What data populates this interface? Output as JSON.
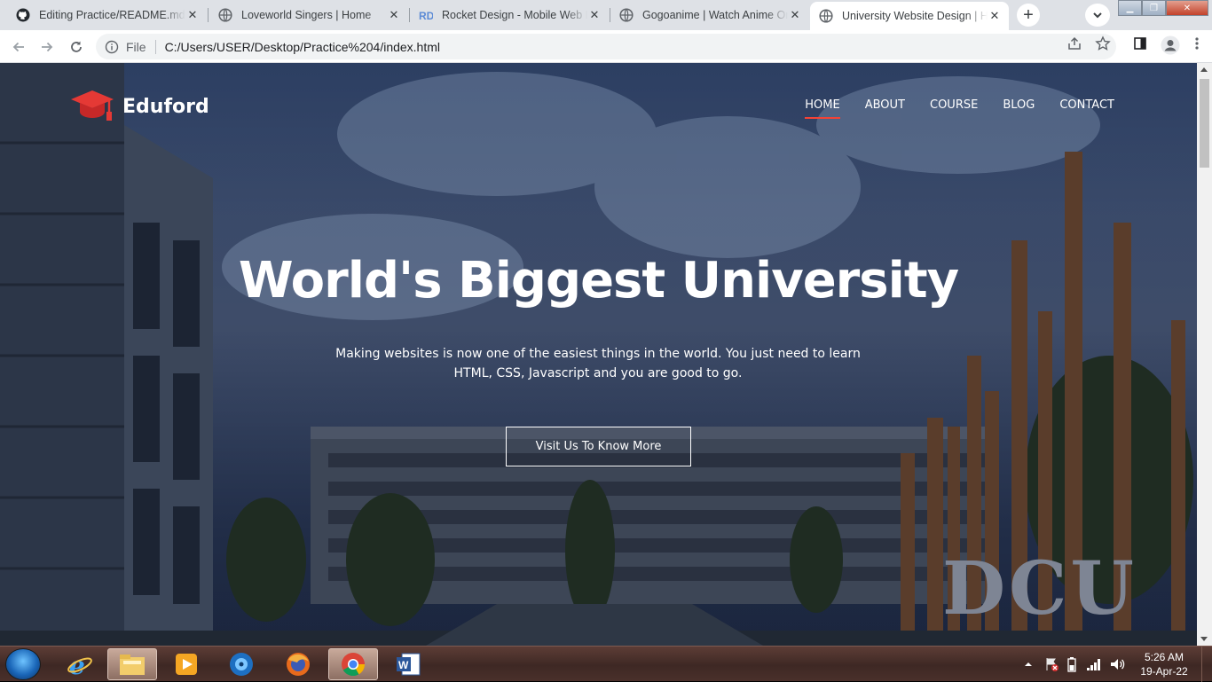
{
  "browser": {
    "tabs": [
      {
        "title": "Editing Practice/README.md a",
        "icon": "github-icon",
        "active": false
      },
      {
        "title": "Loveworld Singers | Home",
        "icon": "globe-icon",
        "active": false
      },
      {
        "title": "Rocket Design - Mobile Web D",
        "icon": "rd-icon",
        "active": false
      },
      {
        "title": "Gogoanime | Watch Anime On",
        "icon": "globe-icon",
        "active": false
      },
      {
        "title": "University Website Design | Ho",
        "icon": "globe-icon",
        "active": true
      }
    ],
    "new_tab_label": "+",
    "address": {
      "scheme_label": "File",
      "url": "C:/Users/USER/Desktop/Practice%204/index.html"
    }
  },
  "site": {
    "brand": "Eduford",
    "nav": [
      {
        "label": "HOME",
        "active": true
      },
      {
        "label": "ABOUT",
        "active": false
      },
      {
        "label": "COURSE",
        "active": false
      },
      {
        "label": "BLOG",
        "active": false
      },
      {
        "label": "CONTACT",
        "active": false
      }
    ],
    "hero": {
      "title": "World's Biggest University",
      "subtitle_line1": "Making websites is now one of the easiest things in the world. You just need to learn",
      "subtitle_line2": "HTML, CSS, Javascript and you are good to go.",
      "cta_label": "Visit Us To Know More"
    },
    "campus_sign": "DCU",
    "accent_color": "#f44336"
  },
  "taskbar": {
    "apps": [
      "internet-explorer-icon",
      "file-explorer-icon",
      "media-player-icon",
      "media-center-icon",
      "firefox-icon",
      "chrome-icon",
      "word-icon"
    ],
    "clock_time": "5:26 AM",
    "clock_date": "19-Apr-22"
  }
}
